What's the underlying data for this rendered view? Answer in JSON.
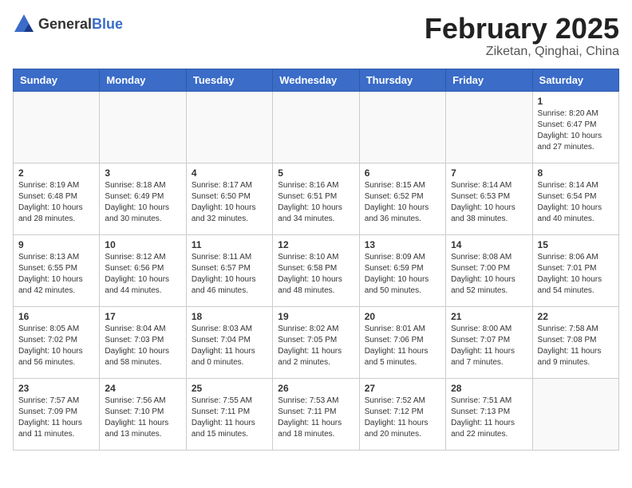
{
  "header": {
    "logo": {
      "text_general": "General",
      "text_blue": "Blue"
    },
    "month": "February 2025",
    "location": "Ziketan, Qinghai, China"
  },
  "weekdays": [
    "Sunday",
    "Monday",
    "Tuesday",
    "Wednesday",
    "Thursday",
    "Friday",
    "Saturday"
  ],
  "weeks": [
    [
      {
        "day": "",
        "info": ""
      },
      {
        "day": "",
        "info": ""
      },
      {
        "day": "",
        "info": ""
      },
      {
        "day": "",
        "info": ""
      },
      {
        "day": "",
        "info": ""
      },
      {
        "day": "",
        "info": ""
      },
      {
        "day": "1",
        "info": "Sunrise: 8:20 AM\nSunset: 6:47 PM\nDaylight: 10 hours\nand 27 minutes."
      }
    ],
    [
      {
        "day": "2",
        "info": "Sunrise: 8:19 AM\nSunset: 6:48 PM\nDaylight: 10 hours\nand 28 minutes."
      },
      {
        "day": "3",
        "info": "Sunrise: 8:18 AM\nSunset: 6:49 PM\nDaylight: 10 hours\nand 30 minutes."
      },
      {
        "day": "4",
        "info": "Sunrise: 8:17 AM\nSunset: 6:50 PM\nDaylight: 10 hours\nand 32 minutes."
      },
      {
        "day": "5",
        "info": "Sunrise: 8:16 AM\nSunset: 6:51 PM\nDaylight: 10 hours\nand 34 minutes."
      },
      {
        "day": "6",
        "info": "Sunrise: 8:15 AM\nSunset: 6:52 PM\nDaylight: 10 hours\nand 36 minutes."
      },
      {
        "day": "7",
        "info": "Sunrise: 8:14 AM\nSunset: 6:53 PM\nDaylight: 10 hours\nand 38 minutes."
      },
      {
        "day": "8",
        "info": "Sunrise: 8:14 AM\nSunset: 6:54 PM\nDaylight: 10 hours\nand 40 minutes."
      }
    ],
    [
      {
        "day": "9",
        "info": "Sunrise: 8:13 AM\nSunset: 6:55 PM\nDaylight: 10 hours\nand 42 minutes."
      },
      {
        "day": "10",
        "info": "Sunrise: 8:12 AM\nSunset: 6:56 PM\nDaylight: 10 hours\nand 44 minutes."
      },
      {
        "day": "11",
        "info": "Sunrise: 8:11 AM\nSunset: 6:57 PM\nDaylight: 10 hours\nand 46 minutes."
      },
      {
        "day": "12",
        "info": "Sunrise: 8:10 AM\nSunset: 6:58 PM\nDaylight: 10 hours\nand 48 minutes."
      },
      {
        "day": "13",
        "info": "Sunrise: 8:09 AM\nSunset: 6:59 PM\nDaylight: 10 hours\nand 50 minutes."
      },
      {
        "day": "14",
        "info": "Sunrise: 8:08 AM\nSunset: 7:00 PM\nDaylight: 10 hours\nand 52 minutes."
      },
      {
        "day": "15",
        "info": "Sunrise: 8:06 AM\nSunset: 7:01 PM\nDaylight: 10 hours\nand 54 minutes."
      }
    ],
    [
      {
        "day": "16",
        "info": "Sunrise: 8:05 AM\nSunset: 7:02 PM\nDaylight: 10 hours\nand 56 minutes."
      },
      {
        "day": "17",
        "info": "Sunrise: 8:04 AM\nSunset: 7:03 PM\nDaylight: 10 hours\nand 58 minutes."
      },
      {
        "day": "18",
        "info": "Sunrise: 8:03 AM\nSunset: 7:04 PM\nDaylight: 11 hours\nand 0 minutes."
      },
      {
        "day": "19",
        "info": "Sunrise: 8:02 AM\nSunset: 7:05 PM\nDaylight: 11 hours\nand 2 minutes."
      },
      {
        "day": "20",
        "info": "Sunrise: 8:01 AM\nSunset: 7:06 PM\nDaylight: 11 hours\nand 5 minutes."
      },
      {
        "day": "21",
        "info": "Sunrise: 8:00 AM\nSunset: 7:07 PM\nDaylight: 11 hours\nand 7 minutes."
      },
      {
        "day": "22",
        "info": "Sunrise: 7:58 AM\nSunset: 7:08 PM\nDaylight: 11 hours\nand 9 minutes."
      }
    ],
    [
      {
        "day": "23",
        "info": "Sunrise: 7:57 AM\nSunset: 7:09 PM\nDaylight: 11 hours\nand 11 minutes."
      },
      {
        "day": "24",
        "info": "Sunrise: 7:56 AM\nSunset: 7:10 PM\nDaylight: 11 hours\nand 13 minutes."
      },
      {
        "day": "25",
        "info": "Sunrise: 7:55 AM\nSunset: 7:11 PM\nDaylight: 11 hours\nand 15 minutes."
      },
      {
        "day": "26",
        "info": "Sunrise: 7:53 AM\nSunset: 7:11 PM\nDaylight: 11 hours\nand 18 minutes."
      },
      {
        "day": "27",
        "info": "Sunrise: 7:52 AM\nSunset: 7:12 PM\nDaylight: 11 hours\nand 20 minutes."
      },
      {
        "day": "28",
        "info": "Sunrise: 7:51 AM\nSunset: 7:13 PM\nDaylight: 11 hours\nand 22 minutes."
      },
      {
        "day": "",
        "info": ""
      }
    ]
  ]
}
